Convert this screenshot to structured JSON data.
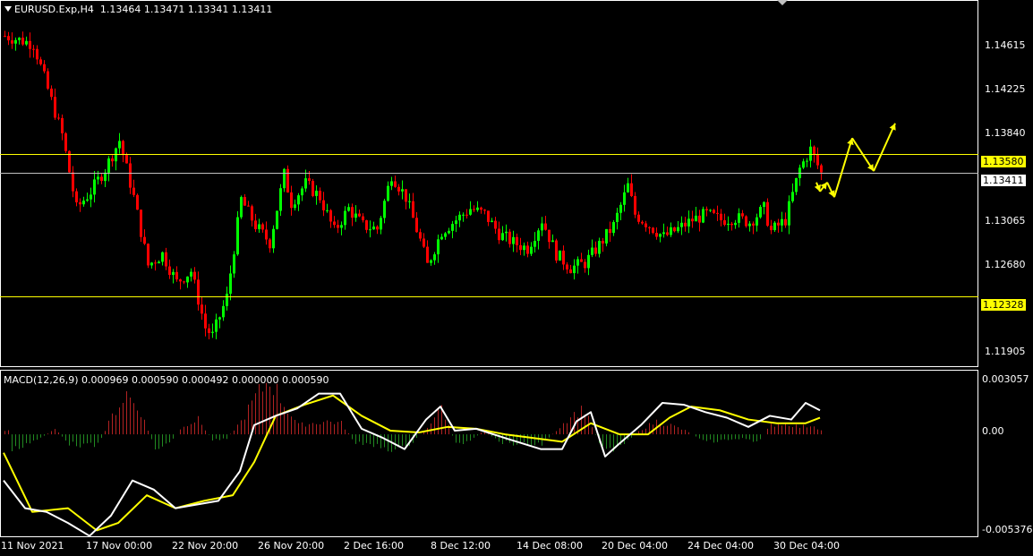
{
  "chart_data": {
    "type": "candlestick",
    "symbol": "EURUSD.Exp",
    "timeframe": "H4",
    "ohlc": {
      "open": "1.13464",
      "high": "1.13471",
      "low": "1.13341",
      "close": "1.13411"
    },
    "price_axis_labels": [
      "1.14615",
      "1.14225",
      "1.13840",
      "1.13065",
      "1.12680",
      "1.11905"
    ],
    "price_range": [
      1.1172,
      1.1492
    ],
    "levels": [
      {
        "name": "resistance",
        "price": 1.1358,
        "label": "1.13580",
        "color": "#ffff00"
      },
      {
        "name": "current",
        "price": 1.13411,
        "label": "1.13411",
        "color": "#c0c0c0"
      },
      {
        "name": "support",
        "price": 1.12328,
        "label": "1.12328",
        "color": "#ffff00"
      }
    ],
    "time_labels": [
      "11 Nov 2021",
      "17 Nov 00:00",
      "22 Nov 20:00",
      "26 Nov 20:00",
      "2 Dec 16:00",
      "8 Dec 12:00",
      "14 Dec 08:00",
      "20 Dec 04:00",
      "24 Dec 04:00",
      "30 Dec 04:00"
    ],
    "close_path": [
      [
        0,
        1.1462
      ],
      [
        8,
        1.1455
      ],
      [
        12,
        1.1415
      ],
      [
        16,
        1.1375
      ],
      [
        20,
        1.131
      ],
      [
        24,
        1.1325
      ],
      [
        28,
        1.1345
      ],
      [
        32,
        1.137
      ],
      [
        36,
        1.132
      ],
      [
        40,
        1.126
      ],
      [
        44,
        1.127
      ],
      [
        48,
        1.1245
      ],
      [
        52,
        1.1255
      ],
      [
        56,
        1.1205
      ],
      [
        58,
        1.1198
      ],
      [
        62,
        1.1232
      ],
      [
        66,
        1.1318
      ],
      [
        70,
        1.1295
      ],
      [
        74,
        1.128
      ],
      [
        78,
        1.134
      ],
      [
        80,
        1.1315
      ],
      [
        84,
        1.1332
      ],
      [
        88,
        1.132
      ],
      [
        92,
        1.129
      ],
      [
        96,
        1.131
      ],
      [
        100,
        1.1295
      ],
      [
        104,
        1.1292
      ],
      [
        108,
        1.134
      ],
      [
        112,
        1.132
      ],
      [
        116,
        1.1282
      ],
      [
        118,
        1.126
      ],
      [
        122,
        1.129
      ],
      [
        126,
        1.13
      ],
      [
        130,
        1.131
      ],
      [
        134,
        1.1305
      ],
      [
        138,
        1.1288
      ],
      [
        142,
        1.128
      ],
      [
        146,
        1.1275
      ],
      [
        150,
        1.13
      ],
      [
        154,
        1.127
      ],
      [
        158,
        1.1258
      ],
      [
        162,
        1.1262
      ],
      [
        166,
        1.1278
      ],
      [
        170,
        1.1295
      ],
      [
        174,
        1.133
      ],
      [
        176,
        1.1305
      ],
      [
        180,
        1.1295
      ],
      [
        184,
        1.1285
      ],
      [
        188,
        1.1292
      ],
      [
        192,
        1.13
      ],
      [
        196,
        1.1305
      ],
      [
        200,
        1.13
      ],
      [
        204,
        1.1302
      ],
      [
        208,
        1.1298
      ],
      [
        212,
        1.131
      ],
      [
        214,
        1.129
      ],
      [
        218,
        1.13
      ],
      [
        222,
        1.1345
      ],
      [
        225,
        1.1362
      ],
      [
        228,
        1.1341
      ]
    ],
    "forecast_arrows_path": [
      [
        227,
        1.1333
      ],
      [
        228,
        1.1325
      ],
      [
        230,
        1.1333
      ],
      [
        232,
        1.132
      ],
      [
        237,
        1.1372
      ],
      [
        243,
        1.1343
      ],
      [
        249,
        1.1385
      ]
    ],
    "macd": {
      "label": "MACD(12,26,9) 0.000969 0.000590 0.000492 0.000000 0.000590",
      "axis_labels": [
        "0.003057",
        "0.00",
        "-0.005376"
      ],
      "range": [
        -0.005376,
        0.003057
      ],
      "main_line": [
        [
          0,
          -0.0025
        ],
        [
          6,
          -0.004
        ],
        [
          12,
          -0.0042
        ],
        [
          18,
          -0.0048
        ],
        [
          24,
          -0.0055
        ],
        [
          30,
          -0.0044
        ],
        [
          36,
          -0.0025
        ],
        [
          42,
          -0.003
        ],
        [
          48,
          -0.004
        ],
        [
          54,
          -0.0038
        ],
        [
          60,
          -0.0036
        ],
        [
          66,
          -0.002
        ],
        [
          70,
          0.0005
        ],
        [
          76,
          0.001
        ],
        [
          82,
          0.0014
        ],
        [
          88,
          0.0022
        ],
        [
          94,
          0.0022
        ],
        [
          100,
          0.0003
        ],
        [
          106,
          -0.0002
        ],
        [
          112,
          -0.0008
        ],
        [
          118,
          0.0008
        ],
        [
          122,
          0.0015
        ],
        [
          126,
          0.0002
        ],
        [
          132,
          0.0003
        ],
        [
          140,
          -0.0002
        ],
        [
          150,
          -0.0008
        ],
        [
          156,
          -0.0008
        ],
        [
          160,
          0.0007
        ],
        [
          164,
          0.0012
        ],
        [
          168,
          -0.0012
        ],
        [
          172,
          -0.0005
        ],
        [
          178,
          0.0005
        ],
        [
          184,
          0.0017
        ],
        [
          190,
          0.0016
        ],
        [
          196,
          0.0012
        ],
        [
          202,
          0.0009
        ],
        [
          208,
          0.0004
        ],
        [
          214,
          0.001
        ],
        [
          220,
          0.0008
        ],
        [
          224,
          0.0017
        ],
        [
          228,
          0.0013
        ]
      ],
      "signal_line": [
        [
          0,
          -0.001
        ],
        [
          8,
          -0.0042
        ],
        [
          18,
          -0.004
        ],
        [
          26,
          -0.0052
        ],
        [
          32,
          -0.0048
        ],
        [
          40,
          -0.0033
        ],
        [
          48,
          -0.004
        ],
        [
          56,
          -0.0036
        ],
        [
          64,
          -0.0033
        ],
        [
          70,
          -0.0015
        ],
        [
          76,
          0.001
        ],
        [
          84,
          0.0016
        ],
        [
          92,
          0.0021
        ],
        [
          100,
          0.001
        ],
        [
          108,
          0.0002
        ],
        [
          116,
          0.0001
        ],
        [
          124,
          0.0004
        ],
        [
          132,
          0.0003
        ],
        [
          140,
          0.0
        ],
        [
          148,
          -0.0002
        ],
        [
          156,
          -0.0004
        ],
        [
          164,
          0.0006
        ],
        [
          172,
          0.0
        ],
        [
          180,
          0.0
        ],
        [
          186,
          0.0009
        ],
        [
          192,
          0.0015
        ],
        [
          200,
          0.0013
        ],
        [
          208,
          0.0008
        ],
        [
          216,
          0.0006
        ],
        [
          224,
          0.0006
        ],
        [
          228,
          0.0009
        ]
      ],
      "histogram": [
        [
          2,
          -0.0009
        ],
        [
          6,
          -0.0005
        ],
        [
          10,
          -0.0002
        ],
        [
          14,
          0.0003
        ],
        [
          18,
          -0.0005
        ],
        [
          22,
          -0.0006
        ],
        [
          26,
          -0.0006
        ],
        [
          30,
          0.001
        ],
        [
          34,
          0.0022
        ],
        [
          38,
          0.0012
        ],
        [
          42,
          -0.0008
        ],
        [
          46,
          -0.0005
        ],
        [
          50,
          0.0005
        ],
        [
          54,
          0.0008
        ],
        [
          58,
          -0.0003
        ],
        [
          62,
          -0.0002
        ],
        [
          66,
          0.0007
        ],
        [
          70,
          0.002
        ],
        [
          74,
          0.003
        ],
        [
          78,
          0.0016
        ],
        [
          82,
          0.0005
        ],
        [
          86,
          0.0006
        ],
        [
          90,
          0.0007
        ],
        [
          94,
          0.0006
        ],
        [
          98,
          -0.0005
        ],
        [
          102,
          -0.0006
        ],
        [
          106,
          -0.0007
        ],
        [
          110,
          -0.0009
        ],
        [
          114,
          -0.0004
        ],
        [
          118,
          0.0004
        ],
        [
          122,
          0.0015
        ],
        [
          126,
          -0.0006
        ],
        [
          130,
          -0.0003
        ],
        [
          134,
          0.0002
        ],
        [
          138,
          -0.0004
        ],
        [
          142,
          -0.0005
        ],
        [
          146,
          -0.0006
        ],
        [
          150,
          -0.0005
        ],
        [
          154,
          0.0002
        ],
        [
          158,
          0.001
        ],
        [
          162,
          0.0014
        ],
        [
          166,
          -0.0005
        ],
        [
          170,
          -0.0008
        ],
        [
          174,
          -0.0003
        ],
        [
          178,
          0.0003
        ],
        [
          182,
          0.0007
        ],
        [
          186,
          0.0005
        ],
        [
          190,
          0.0002
        ],
        [
          194,
          -0.0002
        ],
        [
          198,
          -0.0004
        ],
        [
          202,
          -0.0003
        ],
        [
          206,
          -0.0002
        ],
        [
          210,
          -0.0005
        ],
        [
          214,
          0.0005
        ],
        [
          218,
          0.0006
        ],
        [
          222,
          0.0004
        ],
        [
          226,
          0.0005
        ],
        [
          228,
          0.0002
        ]
      ]
    }
  },
  "colors": {
    "background": "#000000",
    "bull_candle": "#00ff00",
    "bear_candle": "#ff0000",
    "grid_frame": "#ffffff",
    "hist_pos": "#b22222",
    "hist_neg": "#228b22",
    "macd_main": "#ffffff",
    "macd_signal": "#ffff00",
    "forecast_arrows": "#ffff00"
  }
}
